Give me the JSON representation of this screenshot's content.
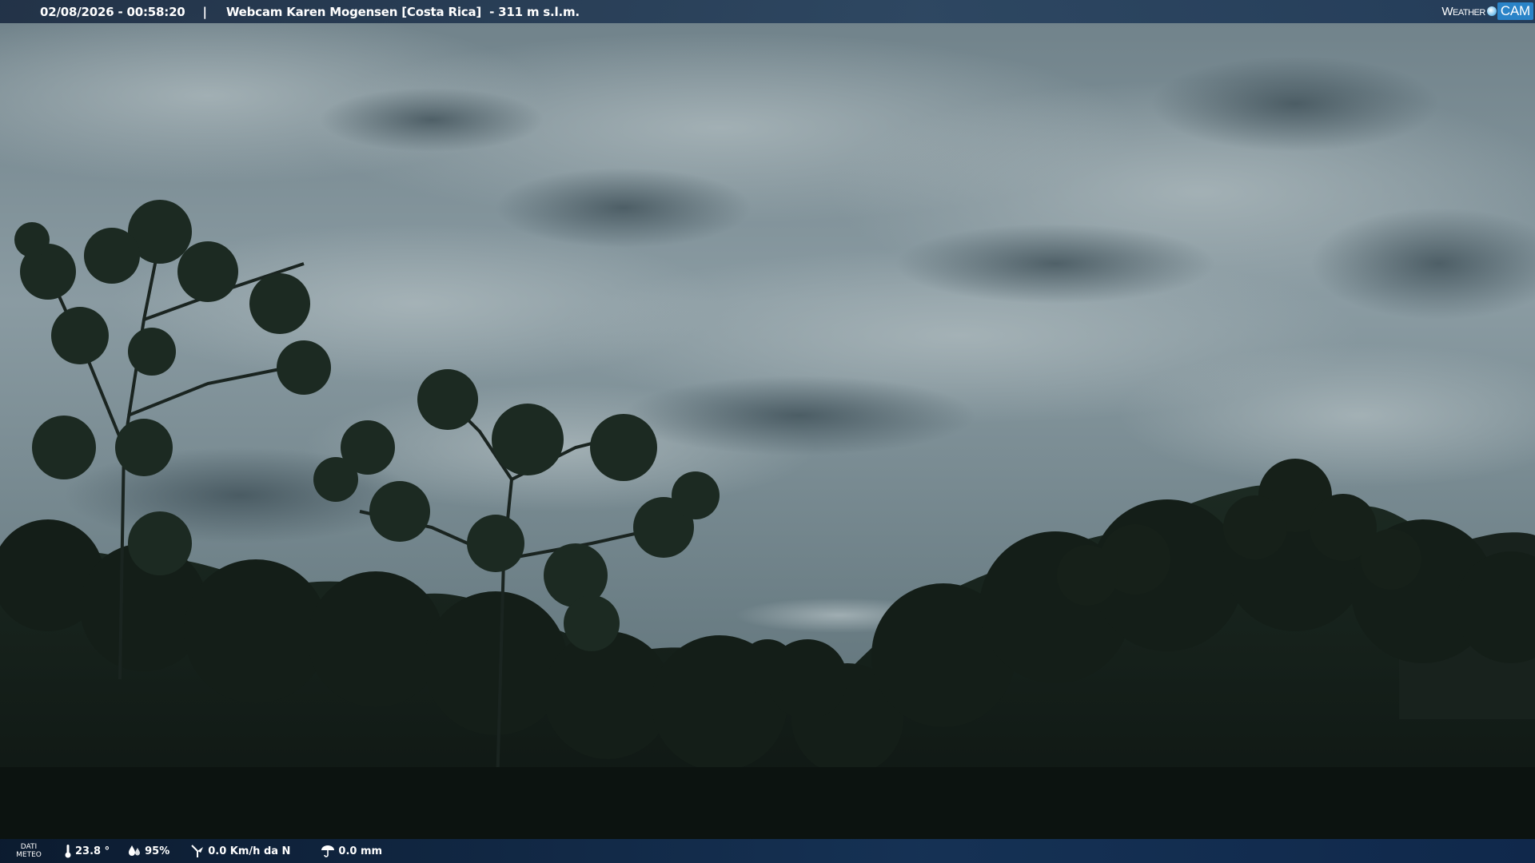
{
  "header": {
    "datetime": "02/08/2026 - 00:58:20",
    "separator": "|",
    "title": "Webcam Karen Mogensen [Costa Rica]  - 311 m s.l.m.",
    "brand_weather": "Weather",
    "brand_cam": "CAM"
  },
  "meteo": {
    "label_line1": "DATI",
    "label_line2": "METEO",
    "temperature": "23.8 °",
    "humidity": "95%",
    "wind": "0.0 Km/h da N",
    "rain": "0.0 mm"
  },
  "colors": {
    "sky": "#8a9ea6",
    "canopy": "#121a15",
    "bar": "#1f3a5e",
    "brand_accent": "#2a84c8"
  },
  "icons": [
    "thermometer-icon",
    "humidity-icon",
    "wind-icon",
    "rain-icon"
  ]
}
